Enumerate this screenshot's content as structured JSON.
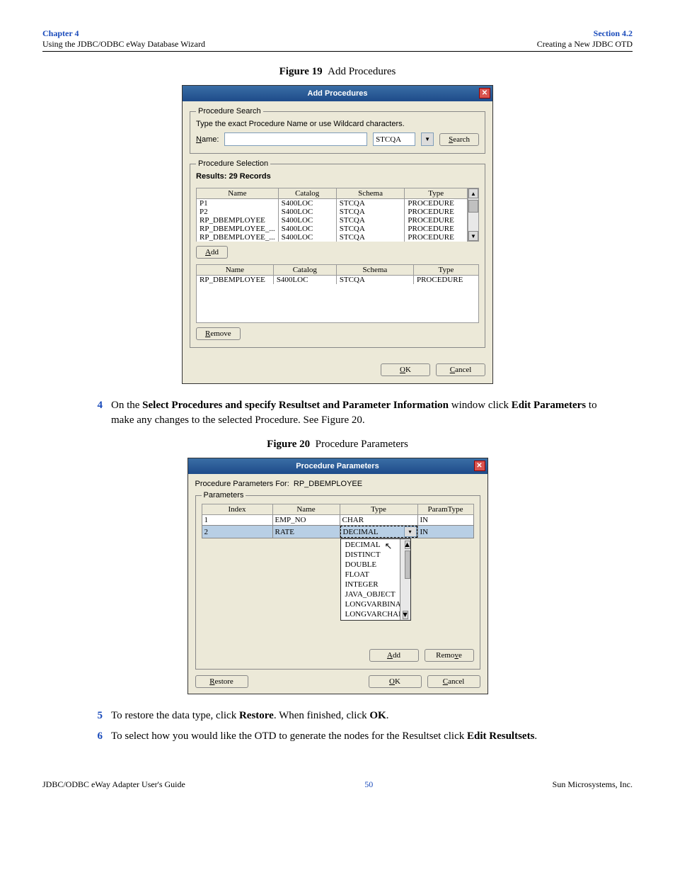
{
  "header": {
    "chapter": "Chapter 4",
    "chapterSub": "Using the JDBC/ODBC eWay Database Wizard",
    "section": "Section 4.2",
    "sectionSub": "Creating a New JDBC OTD"
  },
  "figure19": {
    "label": "Figure 19",
    "title": "Add Procedures"
  },
  "addProceduresDialog": {
    "title": "Add Procedures",
    "procedureSearchLegend": "Procedure Search",
    "hint": "Type the exact Procedure Name or use Wildcard characters.",
    "nameLabel": "Name:",
    "schemaValue": "STCQA",
    "searchBtn": "Search",
    "procedureSelectionLegend": "Procedure Selection",
    "resultsLabel": "Results:  29 Records",
    "cols": {
      "name": "Name",
      "catalog": "Catalog",
      "schema": "Schema",
      "type": "Type"
    },
    "resultsRows": [
      {
        "name": "P1",
        "catalog": "S400LOC",
        "schema": "STCQA",
        "type": "PROCEDURE"
      },
      {
        "name": "P2",
        "catalog": "S400LOC",
        "schema": "STCQA",
        "type": "PROCEDURE"
      },
      {
        "name": "RP_DBEMPLOYEE",
        "catalog": "S400LOC",
        "schema": "STCQA",
        "type": "PROCEDURE"
      },
      {
        "name": "RP_DBEMPLOYEE_...",
        "catalog": "S400LOC",
        "schema": "STCQA",
        "type": "PROCEDURE"
      },
      {
        "name": "RP_DBEMPLOYEE_...",
        "catalog": "S400LOC",
        "schema": "STCQA",
        "type": "PROCEDURE"
      }
    ],
    "addBtn": "Add",
    "selectedRows": [
      {
        "name": "RP_DBEMPLOYEE",
        "catalog": "S400LOC",
        "schema": "STCQA",
        "type": "PROCEDURE"
      }
    ],
    "removeBtn": "Remove",
    "okBtn": "OK",
    "cancelBtn": "Cancel"
  },
  "step4": {
    "num": "4",
    "prefix": "On the ",
    "bold1": "Select Procedures and specify Resultset and Parameter Information",
    "mid": " window click ",
    "bold2": "Edit Parameters",
    "suffix": " to make any changes to the selected Procedure. See Figure 20."
  },
  "figure20": {
    "label": "Figure 20",
    "title": "Procedure Parameters"
  },
  "procedureParamsDialog": {
    "title": "Procedure Parameters",
    "forLabel": "Procedure Parameters For:",
    "forValue": "RP_DBEMPLOYEE",
    "parametersLegend": "Parameters",
    "cols": {
      "index": "Index",
      "name": "Name",
      "type": "Type",
      "paramType": "ParamType"
    },
    "rows": [
      {
        "index": "1",
        "name": "EMP_NO",
        "type": "CHAR",
        "paramType": "IN"
      },
      {
        "index": "2",
        "name": "RATE",
        "type": "DECIMAL",
        "paramType": "IN"
      }
    ],
    "dropdownOptions": [
      "DECIMAL",
      "DISTINCT",
      "DOUBLE",
      "FLOAT",
      "INTEGER",
      "JAVA_OBJECT",
      "LONGVARBINAR",
      "LONGVARCHAR"
    ],
    "addBtn": "Add",
    "removeBtn": "Remove",
    "restoreBtn": "Restore",
    "okBtn": "OK",
    "cancelBtn": "Cancel"
  },
  "step5": {
    "num": "5",
    "prefix": "To restore the data type, click ",
    "bold1": "Restore",
    "mid": ". When finished, click ",
    "bold2": "OK",
    "suffix": "."
  },
  "step6": {
    "num": "6",
    "prefix": "To select how you would like the OTD to generate the nodes for the Resultset click ",
    "bold1": "Edit Resultsets",
    "suffix": "."
  },
  "footer": {
    "left": "JDBC/ODBC eWay Adapter User's Guide",
    "center": "50",
    "right": "Sun Microsystems, Inc."
  }
}
